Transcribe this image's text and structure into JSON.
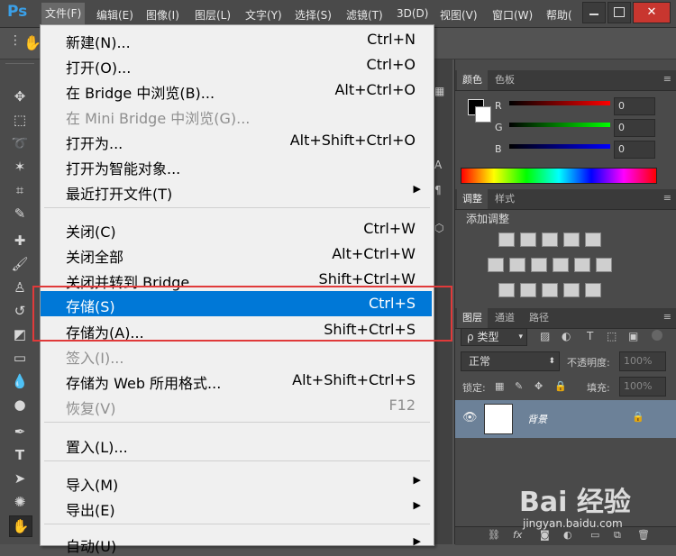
{
  "app": {
    "logo": "Ps"
  },
  "menubar": {
    "items": [
      "文件(F)",
      "编辑(E)",
      "图像(I)",
      "图层(L)",
      "文字(Y)",
      "选择(S)",
      "滤镜(T)",
      "3D(D)",
      "视图(V)",
      "窗口(W)",
      "帮助("
    ]
  },
  "file_menu": {
    "items": [
      {
        "label": "新建(N)...",
        "shortcut": "Ctrl+N"
      },
      {
        "label": "打开(O)...",
        "shortcut": "Ctrl+O"
      },
      {
        "label": "在 Bridge 中浏览(B)...",
        "shortcut": "Alt+Ctrl+O"
      },
      {
        "label": "在 Mini Bridge 中浏览(G)...",
        "shortcut": ""
      },
      {
        "label": "打开为...",
        "shortcut": "Alt+Shift+Ctrl+O"
      },
      {
        "label": "打开为智能对象...",
        "shortcut": ""
      },
      {
        "label": "最近打开文件(T)",
        "shortcut": ""
      },
      {
        "label": "关闭(C)",
        "shortcut": "Ctrl+W"
      },
      {
        "label": "关闭全部",
        "shortcut": "Alt+Ctrl+W"
      },
      {
        "label": "关闭并转到 Bridge...",
        "shortcut": "Shift+Ctrl+W"
      },
      {
        "label": "存储(S)",
        "shortcut": "Ctrl+S"
      },
      {
        "label": "存储为(A)...",
        "shortcut": "Shift+Ctrl+S"
      },
      {
        "label": "签入(I)...",
        "shortcut": ""
      },
      {
        "label": "存储为 Web 所用格式...",
        "shortcut": "Alt+Shift+Ctrl+S"
      },
      {
        "label": "恢复(V)",
        "shortcut": "F12"
      },
      {
        "label": "置入(L)...",
        "shortcut": ""
      },
      {
        "label": "导入(M)",
        "shortcut": ""
      },
      {
        "label": "导出(E)",
        "shortcut": ""
      },
      {
        "label": "自动(U)",
        "shortcut": ""
      }
    ]
  },
  "color_panel": {
    "tabs": [
      "颜色",
      "色板"
    ],
    "channels": [
      {
        "label": "R",
        "value": "0"
      },
      {
        "label": "G",
        "value": "0"
      },
      {
        "label": "B",
        "value": "0"
      }
    ]
  },
  "adjust_panel": {
    "tabs": [
      "调整",
      "样式"
    ],
    "title": "添加调整"
  },
  "layers_panel": {
    "tabs": [
      "图层",
      "通道",
      "路径"
    ],
    "filter_label": "类型",
    "blend_mode": "正常",
    "opacity_label": "不透明度:",
    "opacity_value": "100%",
    "lock_label": "锁定:",
    "fill_label": "填充:",
    "fill_value": "100%",
    "layer_name": "背景"
  },
  "watermark": {
    "brand": "Bai 经验",
    "url": "jingyan.baidu.com"
  },
  "colors": {
    "selection": "#0078d7",
    "highlight_box": "#e03a3a",
    "ps_blue": "#3aa0e8"
  }
}
